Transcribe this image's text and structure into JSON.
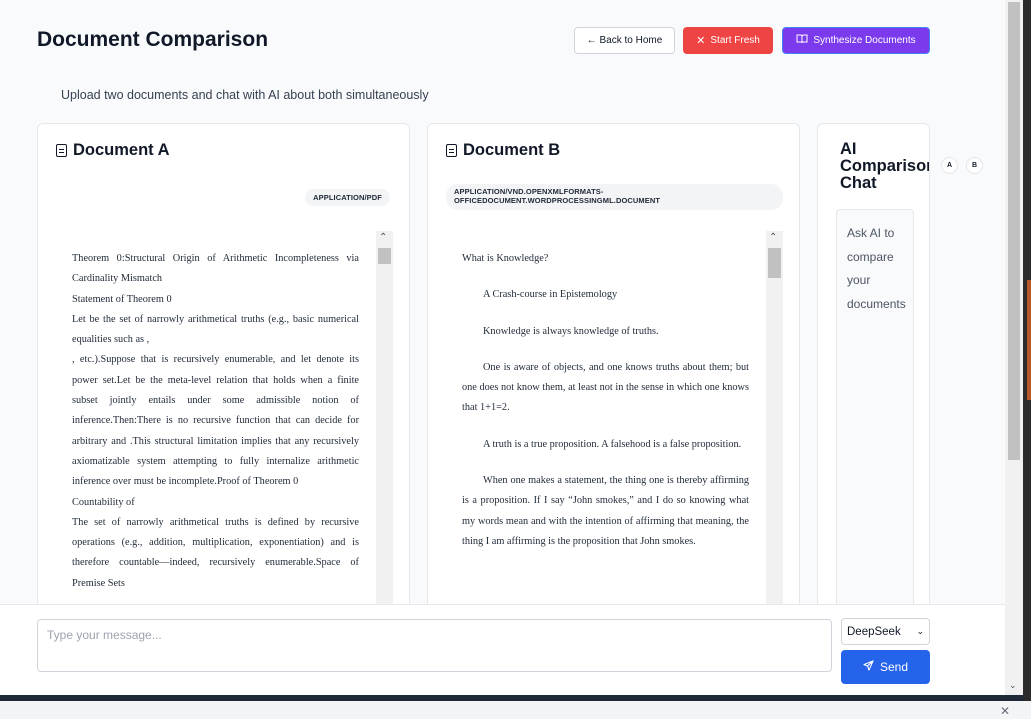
{
  "header": {
    "title": "Document Comparison",
    "subtitle": "Upload two documents and chat with AI about both simultaneously",
    "back_label": "← Back to Home",
    "fresh_label": "Start Fresh",
    "synth_label": "Synthesize Documents"
  },
  "doc_a": {
    "title": "Document A",
    "mime": "APPLICATION/PDF",
    "paragraphs": [
      "Theorem 0:Structural Origin of Arithmetic Incompleteness via Cardinality Mismatch",
      "Statement of Theorem 0",
      "Let be the set of narrowly arithmetical truths (e.g., basic numerical equalities such as ,",
      ", etc.).Suppose that is recursively enumerable, and let denote its power set.Let be the meta-level relation that holds when a finite subset jointly entails under some admissible notion of inference.Then:There is no recursive function that can decide for arbitrary and .This structural limitation implies that any recursively axiomatizable system attempting to fully internalize arithmetic inference over must be incomplete.Proof of Theorem 0",
      "Countability of",
      "The set of narrowly arithmetical truths is defined by recursive operations (e.g., addition, multiplication, exponentiation) and is therefore countable—indeed, recursively enumerable.Space of Premise Sets"
    ]
  },
  "doc_b": {
    "title": "Document B",
    "mime": "APPLICATION/VND.OPENXMLFORMATS-OFFICEDOCUMENT.WORDPROCESSINGML.DOCUMENT",
    "paragraphs": [
      "What is Knowledge?",
      "A Crash-course in Epistemology",
      "Knowledge is always knowledge of truths.",
      "One is aware of objects, and one knows truths about them; but one does not know them, at least not in the sense in which one knows that 1+1=2.",
      "A truth is a true proposition. A falsehood is a false proposition.",
      "When one makes a statement, the thing one is thereby affirming is a proposition. If I say “John smokes,” and I do so knowing what my words mean and with the intention of affirming that meaning, the thing I am affirming is the proposition that John smokes."
    ]
  },
  "chat": {
    "title": "AI Comparison Chat",
    "badge_a": "A",
    "badge_b": "B",
    "prompt": "Ask AI to compare your documents"
  },
  "input": {
    "placeholder": "Type your message...",
    "model": "DeepSeek",
    "send_label": "Send"
  },
  "icons": {
    "fresh": "x-icon",
    "synth": "book-open-icon",
    "doc": "file-text-icon",
    "send": "send-icon"
  },
  "colors": {
    "accent": "#2563eb",
    "danger": "#ef4444",
    "purple": "#7c3aed"
  }
}
